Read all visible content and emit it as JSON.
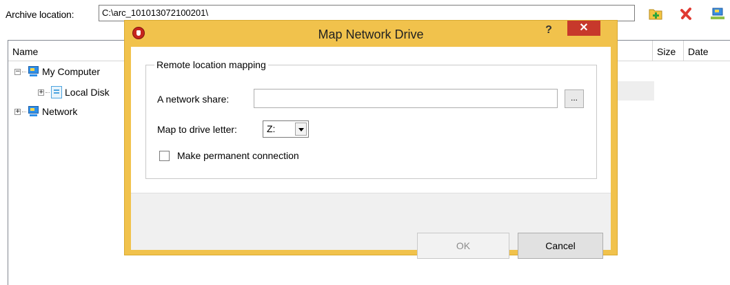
{
  "app": {
    "archive_label": "Archive location:",
    "archive_value": "C:\\arc_101013072100201\\",
    "toolbar_icons": [
      "add-folder-icon",
      "delete-icon",
      "network-icon"
    ],
    "columns": [
      "Name",
      "Size",
      "Date"
    ],
    "tree": [
      {
        "label": "My Computer",
        "expander": "−",
        "icon": "computer-icon"
      },
      {
        "label": "Local Disk",
        "expander": "+",
        "icon": "disk-icon"
      },
      {
        "label": "Network",
        "expander": "+",
        "icon": "network-icon"
      }
    ]
  },
  "dialog": {
    "title": "Map Network Drive",
    "help": "?",
    "close": "✕",
    "group_label": "Remote location mapping",
    "share_label": "A network share:",
    "share_value": "",
    "browse_label": "...",
    "drive_label": "Map to drive letter:",
    "drive_value": "Z:",
    "permanent_label": "Make permanent connection",
    "permanent_checked": false,
    "ok_label": "OK",
    "cancel_label": "Cancel"
  },
  "colors": {
    "title_bar": "#f1c24c",
    "close_button": "#c7382b"
  }
}
